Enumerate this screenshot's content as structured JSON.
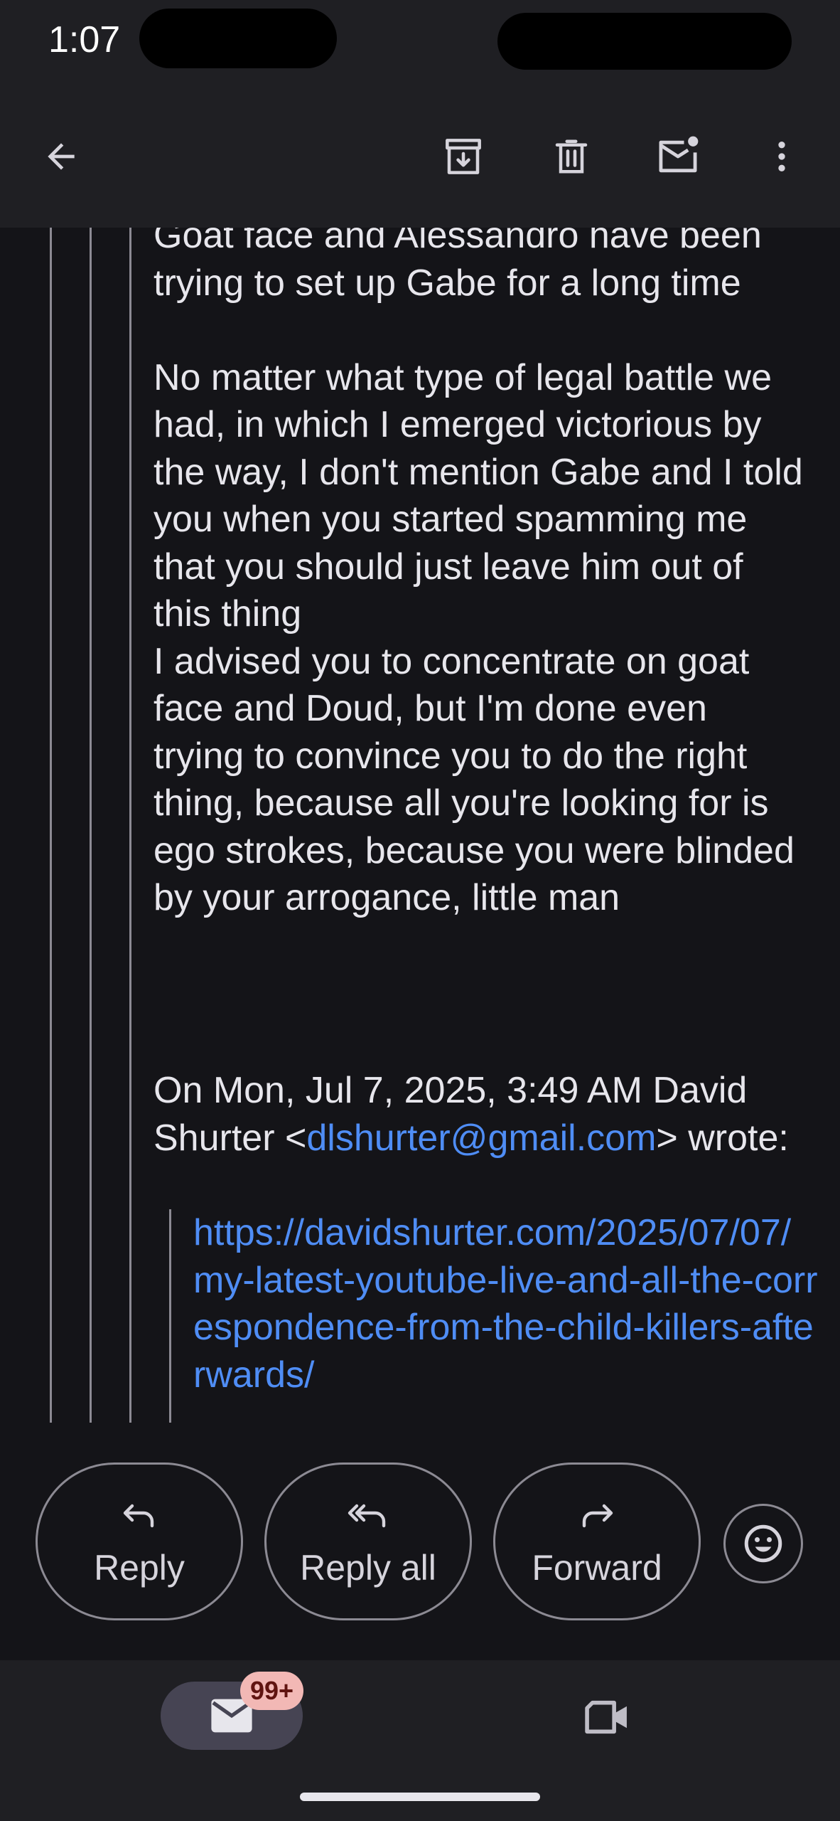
{
  "status_bar": {
    "time": "1:07"
  },
  "app_bar": {
    "icons": [
      "back-arrow-icon",
      "archive-icon",
      "trash-icon",
      "mark-unread-icon",
      "more-vert-icon"
    ]
  },
  "message": {
    "body": "Goat face and Alessandro have been trying to set up Gabe for a long time\n\nNo matter what type of legal battle we had, in which I emerged victorious by the way, I don't mention Gabe and I told you when you started spamming me that you should just leave him out of this thing\nI advised you to concentrate on goat face and Doud, but I'm done even trying to convince you to do the right thing, because all you're looking for is ego strokes, because you were blinded by your arrogance, little man",
    "attribution_prefix": "On Mon, Jul 7, 2025, 3:49 AM David Shurter <",
    "attribution_email": "dlshurter@gmail.com",
    "attribution_suffix": "> wrote:",
    "quoted_link": "https://davidshurter.com/2025/07/07/my-latest-youtube-live-and-all-the-correspondence-from-the-child-killers-afterwards/"
  },
  "actions": {
    "reply_label": "Reply",
    "reply_all_label": "Reply all",
    "forward_label": "Forward"
  },
  "bottom_nav": {
    "mail_badge": "99+"
  },
  "colors": {
    "background": "#141418",
    "bar": "#1f1f23",
    "text": "#e7e6ec",
    "link": "#4f8df5",
    "badge": "#f2b8b5"
  }
}
